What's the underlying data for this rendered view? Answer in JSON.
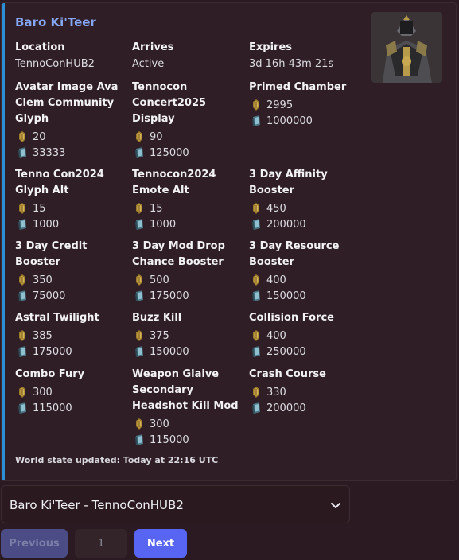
{
  "embed": {
    "title": "Baro Ki'Teer",
    "accent_color": "#2b8fd6",
    "thumbnail_icon": "baro-avatar-icon",
    "info": [
      {
        "name": "Location",
        "value": "TennoConHUB2"
      },
      {
        "name": "Arrives",
        "value": "Active"
      },
      {
        "name": "Expires",
        "value": "3d 16h 43m 21s"
      }
    ],
    "items": [
      {
        "name_lines": [
          "Avatar Image Ava",
          "Clem Community",
          "Glyph"
        ],
        "ducats": "20",
        "credits": "33333"
      },
      {
        "name_lines": [
          "Tennocon",
          "Concert2025",
          "Display"
        ],
        "ducats": "90",
        "credits": "125000"
      },
      {
        "name_lines": [
          "Primed Chamber"
        ],
        "ducats": "2995",
        "credits": "1000000"
      },
      {
        "name_lines": [
          "Tenno Con2024",
          "Glyph Alt"
        ],
        "ducats": "15",
        "credits": "1000"
      },
      {
        "name_lines": [
          "Tennocon2024",
          "Emote Alt"
        ],
        "ducats": "15",
        "credits": "1000"
      },
      {
        "name_lines": [
          "3 Day Affinity",
          "Booster"
        ],
        "ducats": "450",
        "credits": "200000"
      },
      {
        "name_lines": [
          "3 Day Credit",
          "Booster"
        ],
        "ducats": "350",
        "credits": "75000"
      },
      {
        "name_lines": [
          "3 Day Mod Drop",
          "Chance Booster"
        ],
        "ducats": "500",
        "credits": "175000"
      },
      {
        "name_lines": [
          "3 Day Resource",
          "Booster"
        ],
        "ducats": "400",
        "credits": "150000"
      },
      {
        "name_lines": [
          "Astral Twilight"
        ],
        "ducats": "385",
        "credits": "175000"
      },
      {
        "name_lines": [
          "Buzz Kill"
        ],
        "ducats": "375",
        "credits": "150000"
      },
      {
        "name_lines": [
          "Collision Force"
        ],
        "ducats": "400",
        "credits": "250000"
      },
      {
        "name_lines": [
          "Combo Fury"
        ],
        "ducats": "300",
        "credits": "115000"
      },
      {
        "name_lines": [
          "Weapon Glaive",
          "Secondary",
          "Headshot Kill Mod"
        ],
        "ducats": "300",
        "credits": "115000"
      },
      {
        "name_lines": [
          "Crash Course"
        ],
        "ducats": "330",
        "credits": "200000"
      }
    ],
    "footer": "World state updated: Today at 22:16 UTC"
  },
  "select": {
    "value": "Baro Ki'Teer - TennoConHUB2",
    "icon": "chevron-down-icon"
  },
  "pagination": {
    "previous_label": "Previous",
    "page_label": "1",
    "next_label": "Next"
  },
  "icons": {
    "ducat": "ducat-icon",
    "credit": "credit-icon"
  }
}
